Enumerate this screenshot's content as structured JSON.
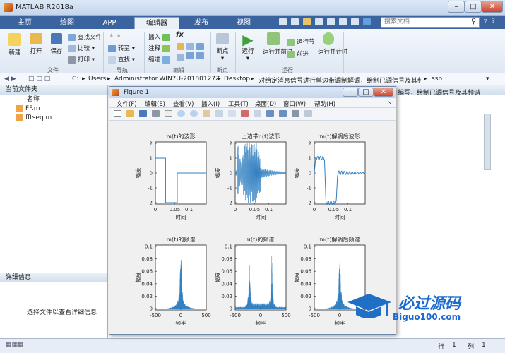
{
  "app": {
    "title": "MATLAB R2018a"
  },
  "tabs": [
    "主页",
    "绘图",
    "APP",
    "编辑器",
    "发布",
    "视图"
  ],
  "search": {
    "placeholder": "搜索文档"
  },
  "ribbon": {
    "new": "新建",
    "open": "打开",
    "save": "保存",
    "find_files": "查找文件",
    "compare": "比较",
    "print": "打印",
    "goto": "转至",
    "find": "查找",
    "insert": "插入",
    "comment": "注释",
    "indent": "缩进",
    "breakpoints": "断点",
    "run": "运行",
    "run_advance": "运行并前进",
    "run_section": "运行节",
    "advance": "前进",
    "run_time": "运行并计时",
    "groups": {
      "file": "文件",
      "nav": "导航",
      "edit": "编辑",
      "bp": "断点",
      "run": "运行"
    },
    "fx": "fx"
  },
  "address": {
    "parts": [
      "C:",
      "Users",
      "Administrator.WIN7U-20180127Z",
      "Desktop",
      "对给定消息信号进行单边带调制解调，绘制已调信号及其频谱",
      "ssb"
    ]
  },
  "current_folder": {
    "title": "当前文件夹",
    "col": "名称",
    "files": [
      "FF.m",
      "fftseq.m"
    ]
  },
  "details": {
    "title": "详细信息",
    "empty": "选择文件以查看详细信息"
  },
  "cmd_overflow": "编写，绘制已调信号及其频谱",
  "status": {
    "line_label": "行",
    "line": "1",
    "col_label": "列",
    "col": "1"
  },
  "figure": {
    "title": "Figure 1",
    "menu": [
      "文件(F)",
      "编辑(E)",
      "查看(V)",
      "插入(I)",
      "工具(T)",
      "桌面(D)",
      "窗口(W)",
      "帮助(H)"
    ],
    "plots": [
      {
        "title": "m(t)的波形",
        "ylabel": "幅度",
        "xlabel": "时间",
        "yticks": [
          "2",
          "1",
          "0",
          "-1",
          "-2"
        ],
        "xticks": [
          "0",
          "0.05",
          "0.1"
        ]
      },
      {
        "title": "上边带u(t)波形",
        "ylabel": "幅度",
        "xlabel": "时间",
        "yticks": [
          "2",
          "1",
          "0",
          "-1",
          "-2"
        ],
        "xticks": [
          "0",
          "0.05",
          "0.1"
        ]
      },
      {
        "title": "m(t)解调后波形",
        "ylabel": "幅度",
        "xlabel": "时间",
        "yticks": [
          "2",
          "1",
          "0",
          "-1",
          "-2"
        ],
        "xticks": [
          "0",
          "0.05",
          "0.1"
        ]
      },
      {
        "title": "m(t)的频谱",
        "ylabel": "幅度",
        "xlabel": "频率",
        "yticks": [
          "0.1",
          "0.08",
          "0.06",
          "0.04",
          "0.02",
          "0"
        ],
        "xticks": [
          "-500",
          "0",
          "500"
        ]
      },
      {
        "title": "u(t)的频谱",
        "ylabel": "幅度",
        "xlabel": "频率",
        "yticks": [
          "0.1",
          "0.08",
          "0.06",
          "0.04",
          "0.02",
          "0"
        ],
        "xticks": [
          "-500",
          "0",
          "500"
        ]
      },
      {
        "title": "m(t)解调后频谱",
        "ylabel": "幅度",
        "xlabel": "频率",
        "yticks": [
          "0.1",
          "0.08",
          "0.06",
          "0.04",
          "0.02",
          "0"
        ],
        "xticks": [
          "-500",
          "0",
          "500"
        ]
      }
    ]
  },
  "watermark": {
    "text": "必过源码",
    "url": "Biguo100.com"
  },
  "colors": {
    "accent": "#3b63a0",
    "plot": "#2f7fc1"
  }
}
